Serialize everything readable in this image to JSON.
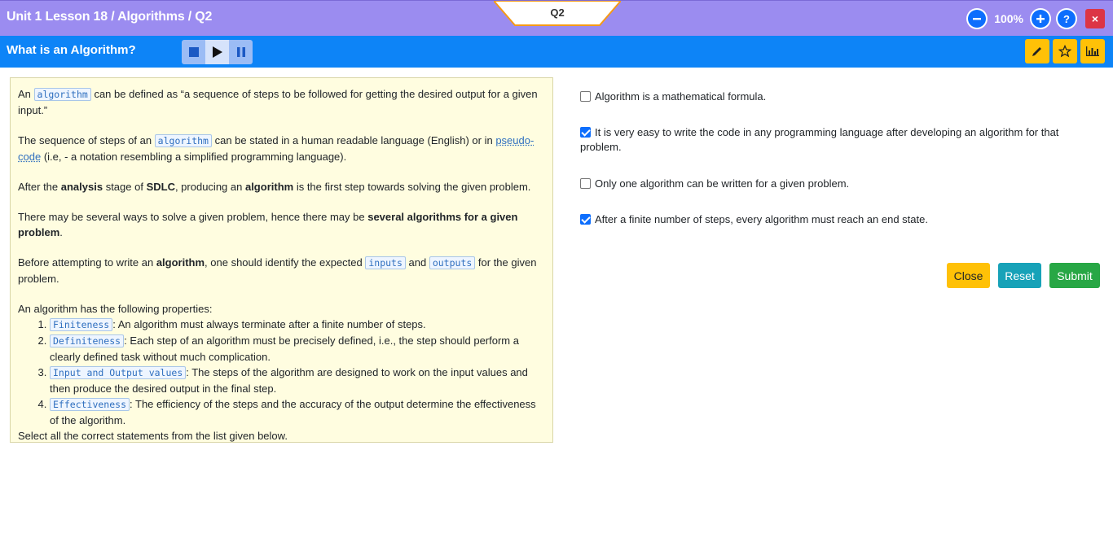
{
  "header": {
    "breadcrumb": "Unit 1 Lesson 18 / Algorithms / Q2",
    "question_tab": "Q2",
    "zoom": "100%",
    "close_label": "×"
  },
  "titlebar": {
    "title": "What is an Algorithm?"
  },
  "content": {
    "p1": {
      "pre": "An ",
      "code": "algorithm",
      "post": " can be defined as “a sequence of steps to be followed for getting the desired output for a given input.”"
    },
    "p2": {
      "pre": "The sequence of steps of an ",
      "code": "algorithm",
      "mid": " can be stated in a human readable language (English) or in ",
      "link": "pseudo-code",
      "post": " (i.e, - a notation resembling a simplified programming language)."
    },
    "p3": {
      "t1": "After the ",
      "b1": "analysis",
      "t2": " stage of ",
      "b2": "SDLC",
      "t3": ", producing an ",
      "b3": "algorithm",
      "t4": " is the first step towards solving the given problem."
    },
    "p4": {
      "t1": "There may be several ways to solve a given problem, hence there may be ",
      "b1": "several algorithms for a given problem",
      "t2": "."
    },
    "p5": {
      "t1": "Before attempting to write an ",
      "b1": "algorithm",
      "t2": ", one should identify the expected ",
      "c1": "inputs",
      "t3": " and ",
      "c2": "outputs",
      "t4": " for the given problem."
    },
    "props_intro": "An algorithm has the following properties:",
    "properties": [
      {
        "code": "Finiteness",
        "text": ": An algorithm must always terminate after a finite number of steps."
      },
      {
        "code": "Definiteness",
        "text": ": Each step of an algorithm must be precisely defined, i.e., the step should perform a clearly defined task without much complication."
      },
      {
        "code": "Input and Output values",
        "text": ": The steps of the algorithm are designed to work on the input values and then produce the desired output in the final step."
      },
      {
        "code": "Effectiveness",
        "text": ": The efficiency of the steps and the accuracy of the output determine the effectiveness of the algorithm."
      }
    ],
    "instruction": "Select all the correct statements from the list given below."
  },
  "options": [
    {
      "label": "Algorithm is a mathematical formula.",
      "checked": false
    },
    {
      "label": "It is very easy to write the code in any programming language after developing an algorithm for that problem.",
      "checked": true
    },
    {
      "label": "Only one algorithm can be written for a given problem.",
      "checked": false
    },
    {
      "label": "After a finite number of steps, every algorithm must reach an end state.",
      "checked": true
    }
  ],
  "actions": {
    "close": "Close",
    "reset": "Reset",
    "submit": "Submit"
  },
  "colors": {
    "topbar": "#9b8cf0",
    "titlebar": "#0d84f7",
    "panel_bg": "#fffde0",
    "accent_yellow": "#ffc107",
    "accent_teal": "#17a2b8",
    "accent_green": "#28a745",
    "danger": "#dc3545"
  },
  "icons": {
    "zoom_out": "minus-circle-icon",
    "zoom_in": "plus-circle-icon",
    "help": "question-circle-icon",
    "close": "close-icon",
    "stop": "stop-icon",
    "play": "play-icon",
    "pause": "pause-icon",
    "edit": "pencil-icon",
    "bookmark": "star-icon",
    "stats": "bar-chart-icon"
  }
}
